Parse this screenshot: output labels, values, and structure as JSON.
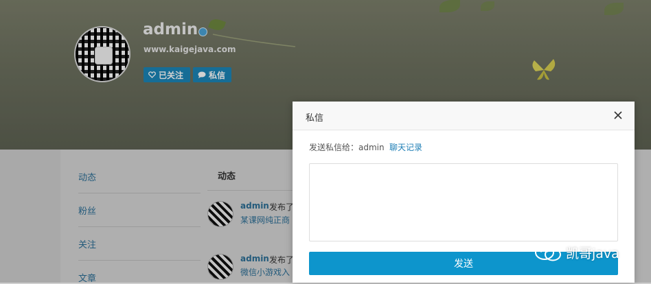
{
  "profile": {
    "username": "admin",
    "website": "www.kaigejava.com",
    "follow_label": "已关注",
    "message_label": "私信"
  },
  "sidebar": {
    "items": [
      {
        "label": "动态"
      },
      {
        "label": "粉丝"
      },
      {
        "label": "关注"
      },
      {
        "label": "文章"
      }
    ]
  },
  "feed": {
    "title": "动态",
    "items": [
      {
        "user": "admin",
        "action": "发布了",
        "text": "某课网纯正商"
      },
      {
        "user": "admin",
        "action": "发布了",
        "text": "微信小游戏入"
      }
    ]
  },
  "modal": {
    "title": "私信",
    "to_label": "发送私信给：",
    "to_name": "admin",
    "history_link": "聊天记录",
    "input_placeholder": "",
    "send_label": "发送"
  },
  "watermark": {
    "text": "凯哥java"
  },
  "colors": {
    "accent": "#0d95cc",
    "link": "#2c6f97",
    "follow_button": "#1c86b8"
  }
}
